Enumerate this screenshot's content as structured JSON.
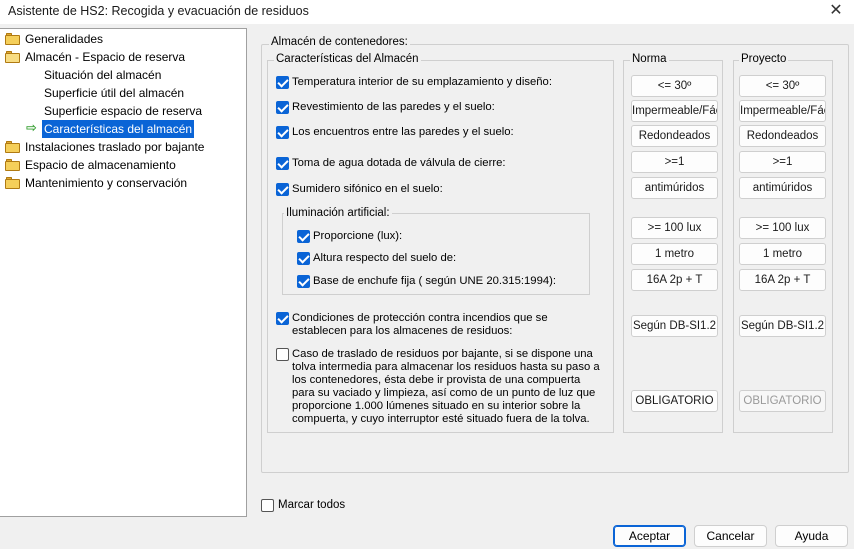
{
  "window": {
    "title": "Asistente de HS2: Recogida y evacuación de residuos",
    "close_glyph": "✕"
  },
  "tree": {
    "items": [
      {
        "label": "Generalidades",
        "icon": "folder-icon"
      },
      {
        "label": "Almacén - Espacio de reserva",
        "icon": "folder-open-icon"
      },
      {
        "label": "Situación del almacén"
      },
      {
        "label": "Superficie útil del almacén"
      },
      {
        "label": "Superficie espacio de reserva"
      },
      {
        "label": "Características del almacén",
        "selected": true,
        "icon": "arrow-right-icon"
      },
      {
        "label": "Instalaciones traslado por bajante",
        "icon": "folder-icon"
      },
      {
        "label": "Espacio de almacenamiento",
        "icon": "folder-icon"
      },
      {
        "label": "Mantenimiento y conservación",
        "icon": "folder-icon"
      }
    ],
    "arrow_glyph": "⇨"
  },
  "main": {
    "group_title": "Almacén de contenedores:",
    "characteristics_title": "Características del Almacén",
    "norma_title": "Norma",
    "proyecto_title": "Proyecto",
    "illumination_title": "Iluminación artificial:",
    "rows": [
      {
        "label": "Temperatura interior de su emplazamiento y diseño:",
        "checked": true,
        "norma": "<= 30º",
        "proyecto": "<= 30º"
      },
      {
        "label": "Revestimiento de las paredes y el suelo:",
        "checked": true,
        "norma": "Impermeable/Fác",
        "proyecto": "Impermeable/Fác"
      },
      {
        "label": "Los encuentros entre las paredes y el suelo:",
        "checked": true,
        "norma": "Redondeados",
        "proyecto": "Redondeados"
      },
      {
        "label": "Toma de agua dotada de válvula de cierre:",
        "checked": true,
        "norma": ">=1",
        "proyecto": ">=1"
      },
      {
        "label": "Sumidero sifónico en el suelo:",
        "checked": true,
        "norma": "antimúridos",
        "proyecto": "antimúridos"
      },
      {
        "label": "Proporcione (lux):",
        "checked": true,
        "norma": ">= 100 lux",
        "proyecto": ">= 100 lux"
      },
      {
        "label": "Altura respecto del suelo de:",
        "checked": true,
        "norma": "1 metro",
        "proyecto": "1 metro"
      },
      {
        "label": "Base de enchufe fija ( según UNE 20.315:1994):",
        "checked": true,
        "norma": "16A 2p + T",
        "proyecto": "16A 2p + T"
      },
      {
        "label": "Condiciones de protección contra incendios que se establecen para los almacenes de residuos:",
        "checked": true,
        "norma": "Según DB-SI1.2",
        "proyecto": "Según DB-SI1.2"
      },
      {
        "label": "Caso de traslado de residuos por bajante, si se dispone una tolva intermedia para almacenar los residuos hasta su paso a los contenedores, ésta debe ir provista de una compuerta para su vaciado y limpieza, así como de un punto de luz que proporcione 1.000 lúmenes situado en su interior sobre la compuerta, y cuyo interruptor esté situado fuera de la tolva.",
        "checked": false,
        "norma": "OBLIGATORIO",
        "proyecto": "OBLIGATORIO",
        "proyecto_disabled": true
      }
    ]
  },
  "footer": {
    "mark_all_label": "Marcar todos",
    "mark_all_checked": false,
    "accept_label": "Aceptar",
    "cancel_label": "Cancelar",
    "help_label": "Ayuda"
  },
  "colors": {
    "accent": "#0a64d6",
    "folder": "#f5cf5a",
    "arrow": "#38a033"
  }
}
